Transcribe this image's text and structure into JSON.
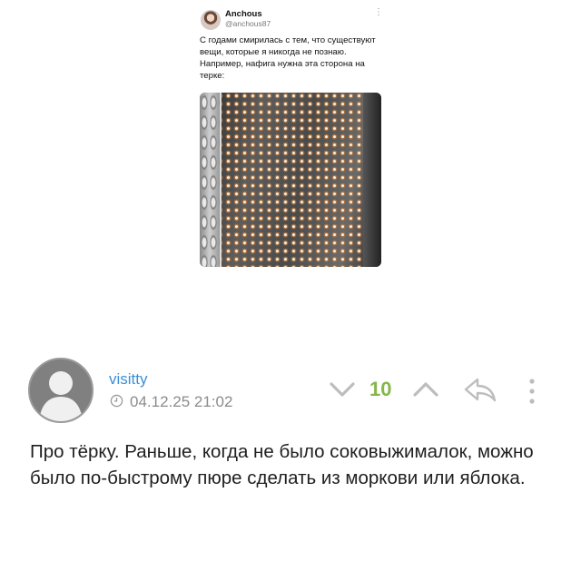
{
  "tweet": {
    "display_name": "Anchous",
    "handle": "@anchous87",
    "text": "С годами смирилась с тем, что существуют вещи, которые я никогда не познаю. Например, нафига нужна эта сторона на терке:",
    "more_glyph": "⋮"
  },
  "comment": {
    "username": "visitty",
    "timestamp": "04.12.25 21:02",
    "score": "10",
    "text": "Про тёрку. Раньше, когда не было соковыжималок, можно было по-быстрому пюре сделать из моркови или яблока."
  },
  "colors": {
    "username": "#3b8fd6",
    "score": "#86b64b",
    "meta": "#8c8c8c",
    "icons": "#c0c0c0"
  },
  "icons": [
    "clock-icon",
    "vote-down-icon",
    "vote-up-icon",
    "reply-icon",
    "more-vertical-icon"
  ]
}
